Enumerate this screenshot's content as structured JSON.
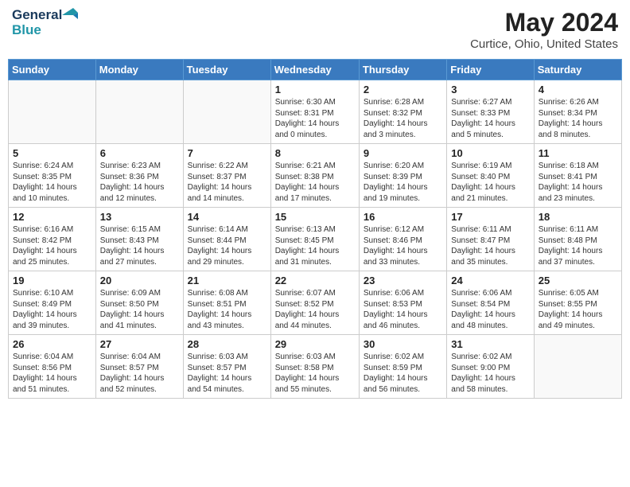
{
  "header": {
    "logo_line1": "General",
    "logo_line2": "Blue",
    "month_title": "May 2024",
    "location": "Curtice, Ohio, United States"
  },
  "weekdays": [
    "Sunday",
    "Monday",
    "Tuesday",
    "Wednesday",
    "Thursday",
    "Friday",
    "Saturday"
  ],
  "weeks": [
    [
      {
        "day": "",
        "info": ""
      },
      {
        "day": "",
        "info": ""
      },
      {
        "day": "",
        "info": ""
      },
      {
        "day": "1",
        "info": "Sunrise: 6:30 AM\nSunset: 8:31 PM\nDaylight: 14 hours\nand 0 minutes."
      },
      {
        "day": "2",
        "info": "Sunrise: 6:28 AM\nSunset: 8:32 PM\nDaylight: 14 hours\nand 3 minutes."
      },
      {
        "day": "3",
        "info": "Sunrise: 6:27 AM\nSunset: 8:33 PM\nDaylight: 14 hours\nand 5 minutes."
      },
      {
        "day": "4",
        "info": "Sunrise: 6:26 AM\nSunset: 8:34 PM\nDaylight: 14 hours\nand 8 minutes."
      }
    ],
    [
      {
        "day": "5",
        "info": "Sunrise: 6:24 AM\nSunset: 8:35 PM\nDaylight: 14 hours\nand 10 minutes."
      },
      {
        "day": "6",
        "info": "Sunrise: 6:23 AM\nSunset: 8:36 PM\nDaylight: 14 hours\nand 12 minutes."
      },
      {
        "day": "7",
        "info": "Sunrise: 6:22 AM\nSunset: 8:37 PM\nDaylight: 14 hours\nand 14 minutes."
      },
      {
        "day": "8",
        "info": "Sunrise: 6:21 AM\nSunset: 8:38 PM\nDaylight: 14 hours\nand 17 minutes."
      },
      {
        "day": "9",
        "info": "Sunrise: 6:20 AM\nSunset: 8:39 PM\nDaylight: 14 hours\nand 19 minutes."
      },
      {
        "day": "10",
        "info": "Sunrise: 6:19 AM\nSunset: 8:40 PM\nDaylight: 14 hours\nand 21 minutes."
      },
      {
        "day": "11",
        "info": "Sunrise: 6:18 AM\nSunset: 8:41 PM\nDaylight: 14 hours\nand 23 minutes."
      }
    ],
    [
      {
        "day": "12",
        "info": "Sunrise: 6:16 AM\nSunset: 8:42 PM\nDaylight: 14 hours\nand 25 minutes."
      },
      {
        "day": "13",
        "info": "Sunrise: 6:15 AM\nSunset: 8:43 PM\nDaylight: 14 hours\nand 27 minutes."
      },
      {
        "day": "14",
        "info": "Sunrise: 6:14 AM\nSunset: 8:44 PM\nDaylight: 14 hours\nand 29 minutes."
      },
      {
        "day": "15",
        "info": "Sunrise: 6:13 AM\nSunset: 8:45 PM\nDaylight: 14 hours\nand 31 minutes."
      },
      {
        "day": "16",
        "info": "Sunrise: 6:12 AM\nSunset: 8:46 PM\nDaylight: 14 hours\nand 33 minutes."
      },
      {
        "day": "17",
        "info": "Sunrise: 6:11 AM\nSunset: 8:47 PM\nDaylight: 14 hours\nand 35 minutes."
      },
      {
        "day": "18",
        "info": "Sunrise: 6:11 AM\nSunset: 8:48 PM\nDaylight: 14 hours\nand 37 minutes."
      }
    ],
    [
      {
        "day": "19",
        "info": "Sunrise: 6:10 AM\nSunset: 8:49 PM\nDaylight: 14 hours\nand 39 minutes."
      },
      {
        "day": "20",
        "info": "Sunrise: 6:09 AM\nSunset: 8:50 PM\nDaylight: 14 hours\nand 41 minutes."
      },
      {
        "day": "21",
        "info": "Sunrise: 6:08 AM\nSunset: 8:51 PM\nDaylight: 14 hours\nand 43 minutes."
      },
      {
        "day": "22",
        "info": "Sunrise: 6:07 AM\nSunset: 8:52 PM\nDaylight: 14 hours\nand 44 minutes."
      },
      {
        "day": "23",
        "info": "Sunrise: 6:06 AM\nSunset: 8:53 PM\nDaylight: 14 hours\nand 46 minutes."
      },
      {
        "day": "24",
        "info": "Sunrise: 6:06 AM\nSunset: 8:54 PM\nDaylight: 14 hours\nand 48 minutes."
      },
      {
        "day": "25",
        "info": "Sunrise: 6:05 AM\nSunset: 8:55 PM\nDaylight: 14 hours\nand 49 minutes."
      }
    ],
    [
      {
        "day": "26",
        "info": "Sunrise: 6:04 AM\nSunset: 8:56 PM\nDaylight: 14 hours\nand 51 minutes."
      },
      {
        "day": "27",
        "info": "Sunrise: 6:04 AM\nSunset: 8:57 PM\nDaylight: 14 hours\nand 52 minutes."
      },
      {
        "day": "28",
        "info": "Sunrise: 6:03 AM\nSunset: 8:57 PM\nDaylight: 14 hours\nand 54 minutes."
      },
      {
        "day": "29",
        "info": "Sunrise: 6:03 AM\nSunset: 8:58 PM\nDaylight: 14 hours\nand 55 minutes."
      },
      {
        "day": "30",
        "info": "Sunrise: 6:02 AM\nSunset: 8:59 PM\nDaylight: 14 hours\nand 56 minutes."
      },
      {
        "day": "31",
        "info": "Sunrise: 6:02 AM\nSunset: 9:00 PM\nDaylight: 14 hours\nand 58 minutes."
      },
      {
        "day": "",
        "info": ""
      }
    ]
  ]
}
